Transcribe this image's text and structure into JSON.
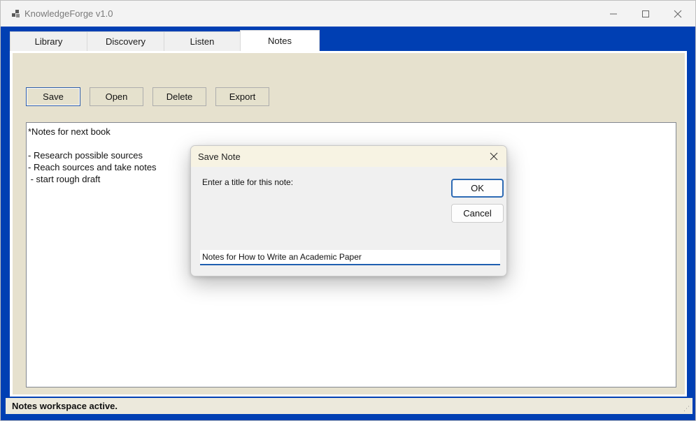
{
  "window": {
    "title": "KnowledgeForge v1.0",
    "icons": {
      "app": "app-icon",
      "minimize": "minimize-icon",
      "maximize": "maximize-icon",
      "close": "close-icon"
    },
    "colors": {
      "frame": "#003fb3",
      "panel": "#e6e1ce"
    }
  },
  "tabs": [
    {
      "label": "Library",
      "active": false
    },
    {
      "label": "Discovery",
      "active": false
    },
    {
      "label": "Listen",
      "active": false
    },
    {
      "label": "Notes",
      "active": true
    }
  ],
  "toolbar": {
    "save_label": "Save",
    "open_label": "Open",
    "delete_label": "Delete",
    "export_label": "Export"
  },
  "editor": {
    "content": "*Notes for next book\n\n- Research possible sources\n- Reach sources and take notes\n - start rough draft"
  },
  "status": {
    "text": "Notes workspace active."
  },
  "dialog": {
    "title": "Save Note",
    "prompt": "Enter a title for this note:",
    "ok_label": "OK",
    "cancel_label": "Cancel",
    "input_value": "Notes for How to Write an Academic Paper"
  }
}
